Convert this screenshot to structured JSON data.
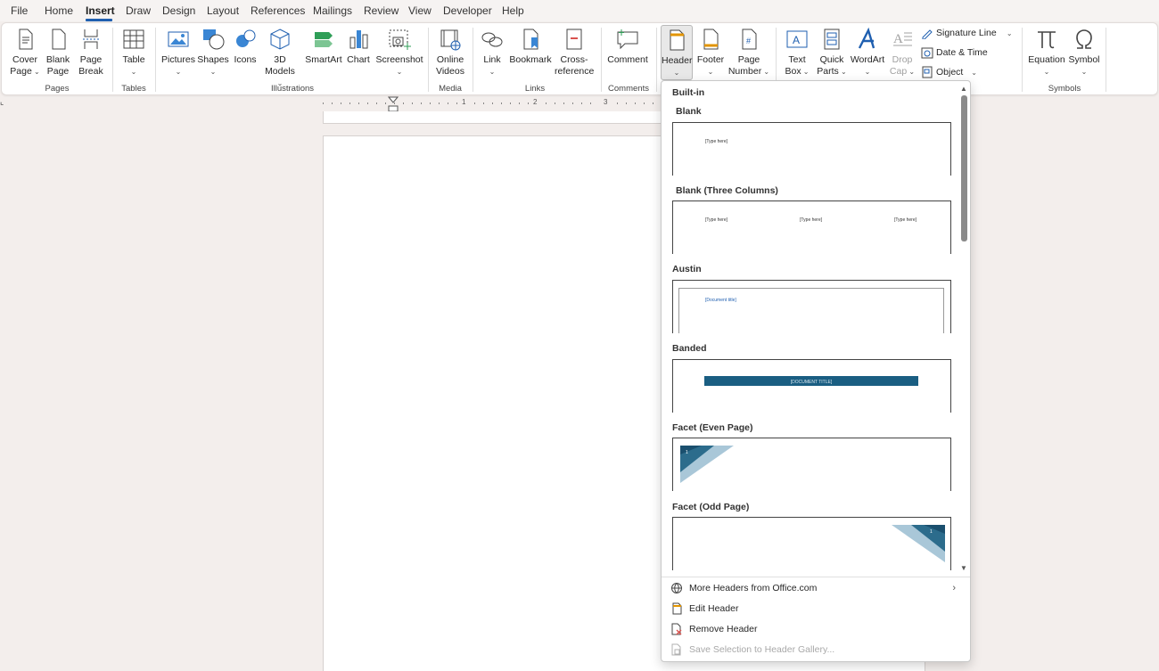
{
  "menu": {
    "tabs": [
      "File",
      "Home",
      "Insert",
      "Draw",
      "Design",
      "Layout",
      "References",
      "Mailings",
      "Review",
      "View",
      "Developer",
      "Help"
    ],
    "active": "Insert"
  },
  "ribbon": {
    "pages": {
      "cover": "Cover\nPage",
      "blank": "Blank\nPage",
      "break": "Page\nBreak",
      "group": "Pages"
    },
    "tables": {
      "table": "Table",
      "group": "Tables"
    },
    "illustrations": {
      "pictures": "Pictures",
      "shapes": "Shapes",
      "icons": "Icons",
      "models": "3D\nModels",
      "smartart": "SmartArt",
      "chart": "Chart",
      "screenshot": "Screenshot",
      "group": "Illustrations"
    },
    "media": {
      "online": "Online\nVideos",
      "group": "Media"
    },
    "links": {
      "link": "Link",
      "bookmark": "Bookmark",
      "cross": "Cross-\nreference",
      "group": "Links"
    },
    "comments": {
      "comment": "Comment",
      "group": "Comments"
    },
    "headerfooter": {
      "header": "Header",
      "footer": "Footer",
      "pagenum": "Page\nNumber"
    },
    "text": {
      "textbox": "Text\nBox",
      "quickparts": "Quick\nParts",
      "wordart": "WordArt",
      "dropcap": "Drop\nCap",
      "sigline": "Signature Line",
      "datetime": "Date & Time",
      "object": "Object"
    },
    "symbols": {
      "equation": "Equation",
      "symbol": "Symbol",
      "group": "Symbols"
    }
  },
  "dropdown": {
    "section": "Built-in",
    "items": [
      {
        "title": "Blank",
        "placeholders": [
          "[Type here]"
        ]
      },
      {
        "title": "Blank (Three Columns)",
        "placeholders": [
          "[Type here]",
          "[Type here]",
          "[Type here]"
        ]
      },
      {
        "title": "Austin",
        "placeholders": [
          "[Document title]"
        ]
      },
      {
        "title": "Banded",
        "placeholders": [
          "[DOCUMENT TITLE]"
        ]
      },
      {
        "title": "Facet (Even Page)",
        "placeholders": [
          "1"
        ]
      },
      {
        "title": "Facet (Odd Page)",
        "placeholders": [
          "1"
        ]
      }
    ],
    "menu": {
      "more": "More Headers from Office.com",
      "edit": "Edit Header",
      "remove": "Remove Header",
      "save": "Save Selection to Header Gallery..."
    }
  },
  "ruler": {
    "numbers": [
      "1",
      "2",
      "3"
    ]
  },
  "colors": {
    "accent": "#1f5fb0",
    "banded": "#1a5e82",
    "facet": "#2c6c8c"
  }
}
